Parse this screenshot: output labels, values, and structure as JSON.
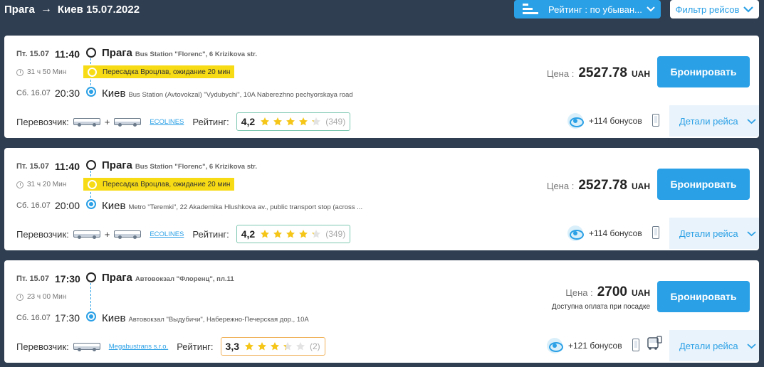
{
  "header": {
    "from": "Прага",
    "to_date": "Киев 15.07.2022",
    "sort_label": "Рейтинг : по убыван...",
    "filter_label": "Фильтр рейсов"
  },
  "colors": {
    "accent": "#2aa0e6",
    "transfer": "#f7dc15",
    "background": "#2f3e51"
  },
  "trips": [
    {
      "dep_date": "Пт. 15.07",
      "dep_time": "11:40",
      "dep_city": "Прага",
      "dep_addr": "Bus Station \"Florenc\", 6 Krizikova str.",
      "duration": "31 ч 50 Мин",
      "transfer": "Пересадка Вроцлав, ожидание 20 мин",
      "arr_date": "Сб. 16.07",
      "arr_time": "20:30",
      "arr_city": "Киев",
      "arr_addr": "Bus Station (Avtovokzal) \"Vydubychi\", 10A Naberezhno pechyorskaya road",
      "price_label": "Цена :",
      "price": "2527.78",
      "currency": "UAH",
      "onboard": "",
      "book_label": "Бронировать",
      "carrier_label": "Перевозчик:",
      "carrier_name": "ECOLINES",
      "plus": "+",
      "rating_label": "Рейтинг:",
      "rating": "4,2",
      "stars": 4.2,
      "reviews": "(349)",
      "bonus": "+114 бонусов",
      "details_label": "Детали рейса"
    },
    {
      "dep_date": "Пт. 15.07",
      "dep_time": "11:40",
      "dep_city": "Прага",
      "dep_addr": "Bus Station \"Florenc\", 6 Krizikova str.",
      "duration": "31 ч 20 Мин",
      "transfer": "Пересадка Вроцлав, ожидание 20 мин",
      "arr_date": "Сб. 16.07",
      "arr_time": "20:00",
      "arr_city": "Киев",
      "arr_addr": "Metro \"Teremki\", 22 Akademika Hlushkova av., public transport stop (across ...",
      "price_label": "Цена :",
      "price": "2527.78",
      "currency": "UAH",
      "onboard": "",
      "book_label": "Бронировать",
      "carrier_label": "Перевозчик:",
      "carrier_name": "ECOLINES",
      "plus": "+",
      "rating_label": "Рейтинг:",
      "rating": "4,2",
      "stars": 4.2,
      "reviews": "(349)",
      "bonus": "+114 бонусов",
      "details_label": "Детали рейса"
    },
    {
      "dep_date": "Пт. 15.07",
      "dep_time": "17:30",
      "dep_city": "Прага",
      "dep_addr": "Автовокзал \"Флоренц\", пл.11",
      "duration": "23 ч 00 Мин",
      "transfer": "",
      "arr_date": "Сб. 16.07",
      "arr_time": "17:30",
      "arr_city": "Киев",
      "arr_addr": "Автовокзал \"Выдубичи\", Набережно-Печерская дор., 10А",
      "price_label": "Цена :",
      "price": "2700",
      "currency": "UAH",
      "onboard": "Доступна оплата при посадке",
      "book_label": "Бронировать",
      "carrier_label": "Перевозчик:",
      "carrier_name": "Megabustrans s.r.o.",
      "plus": "",
      "rating_label": "Рейтинг:",
      "rating": "3,3",
      "stars": 3.3,
      "reviews": "(2)",
      "bonus": "+121 бонусов",
      "details_label": "Детали рейса"
    }
  ]
}
